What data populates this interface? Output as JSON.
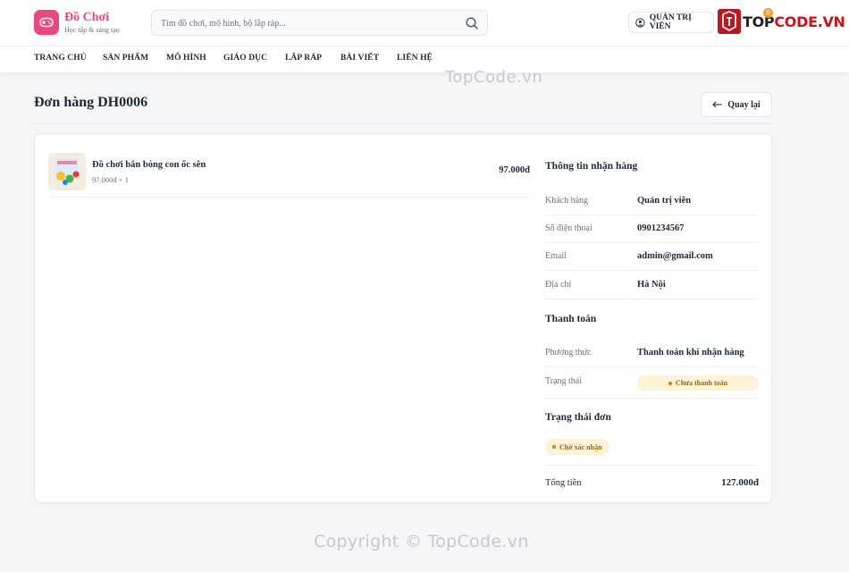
{
  "header": {
    "logo_title": "Đồ Chơi",
    "logo_subtitle": "Học tập & sáng tạo",
    "search_placeholder": "Tìm đồ chơi, mô hình, bộ lắp ráp...",
    "account_label": "QUẢN TRỊ VIÊN",
    "brand": "TOPCODE.VN",
    "brand_prefix": "TOP",
    "brand_suffix": "CODE.VN",
    "brand_badge": "0"
  },
  "nav": [
    "TRANG CHỦ",
    "SẢN PHẨM",
    "MÔ HÌNH",
    "GIÁO DỤC",
    "LẮP RÁP",
    "BÀI VIẾT",
    "LIÊN HỆ"
  ],
  "watermark_top": "TopCode.vn",
  "page": {
    "title": "Đơn hàng DH0006",
    "back_label": "Quay lại"
  },
  "order_items": [
    {
      "name": "Đồ chơi bắn bóng con ốc sên",
      "meta": "97.000đ × 1",
      "price": "97.000đ"
    }
  ],
  "receiver": {
    "title": "Thông tin nhận hàng",
    "rows": [
      {
        "label": "Khách hàng",
        "value": "Quản trị viên"
      },
      {
        "label": "Số điện thoại",
        "value": "0901234567"
      },
      {
        "label": "Email",
        "value": "admin@gmail.com"
      },
      {
        "label": "Địa chỉ",
        "value": "Hà Nội"
      }
    ]
  },
  "payment": {
    "title": "Thanh toán",
    "method_label": "Phương thức",
    "method_value": "Thanh toán khi nhận hàng",
    "status_label": "Trạng thái",
    "status_value": "Chưa thanh toán"
  },
  "order_status": {
    "title": "Trạng thái đơn",
    "value": "Chờ xác nhận"
  },
  "total": {
    "label": "Tổng tiền",
    "value": "127.000đ"
  },
  "watermark_bottom": "Copyright © TopCode.vn",
  "colors": {
    "accent": "#e8497a",
    "badge_bg": "#fdf1d8",
    "badge_text": "#9a6a12",
    "brand_red": "#c4161c"
  }
}
